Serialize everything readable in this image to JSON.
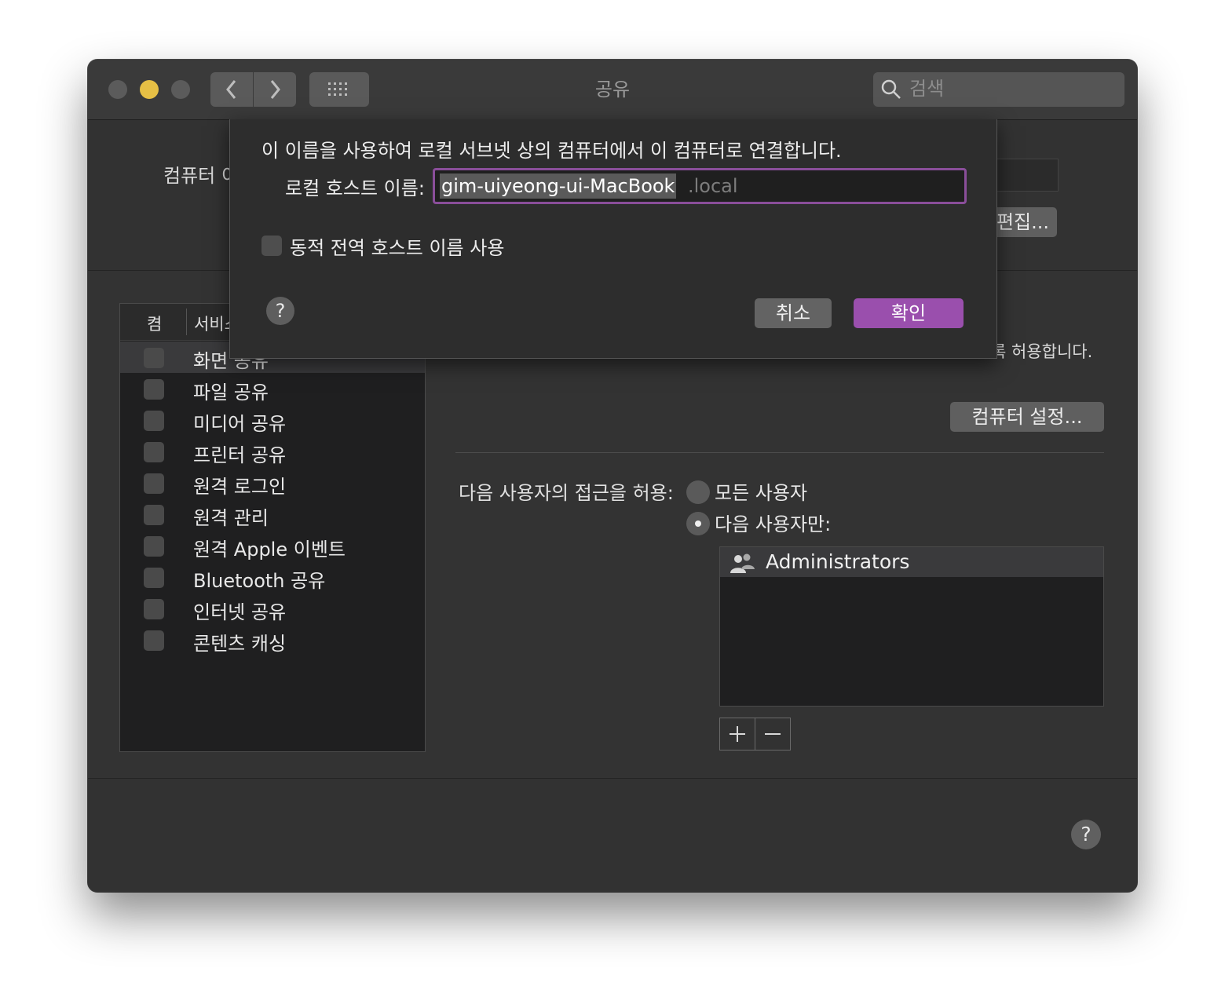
{
  "window": {
    "title": "공유",
    "search_placeholder": "검색"
  },
  "background": {
    "computer_name_label": "컴퓨터 이",
    "edit_button": "편집...",
    "service_table": {
      "col_on": "켬",
      "col_service": "서비스",
      "services": [
        {
          "label": "화면 공유",
          "selected": true
        },
        {
          "label": "파일 공유"
        },
        {
          "label": "미디어 공유"
        },
        {
          "label": "프린터 공유"
        },
        {
          "label": "원격 로그인"
        },
        {
          "label": "원격 관리"
        },
        {
          "label": "원격 Apple 이벤트"
        },
        {
          "label": "Bluetooth 공유"
        },
        {
          "label": "인터넷 공유"
        },
        {
          "label": "콘텐츠 캐싱"
        }
      ]
    },
    "description_partial": "록 허용합니다.",
    "computer_settings_button": "컴퓨터 설정...",
    "access_label": "다음 사용자의 접근을 허용:",
    "radio_all_users": "모든 사용자",
    "radio_only_users": "다음 사용자만:",
    "selected_radio": "only",
    "users": [
      "Administrators"
    ],
    "add_symbol": "+",
    "remove_symbol": "−"
  },
  "sheet": {
    "message": "이 이름을 사용하여 로컬 서브넷 상의 컴퓨터에서 이 컴퓨터로 연결합니다.",
    "host_label": "로컬 호스트 이름:",
    "host_value": "gim-uiyeong-ui-MacBook",
    "host_suffix": ".local",
    "dynamic_checkbox_label": "동적 전역 호스트 이름 사용",
    "dynamic_checked": false,
    "help_symbol": "?",
    "cancel_button": "취소",
    "ok_button": "확인"
  },
  "help_symbol": "?",
  "colors": {
    "accent": "#9a4fad",
    "window_bg": "#323232",
    "traffic_yellow": "#e6bf45"
  }
}
